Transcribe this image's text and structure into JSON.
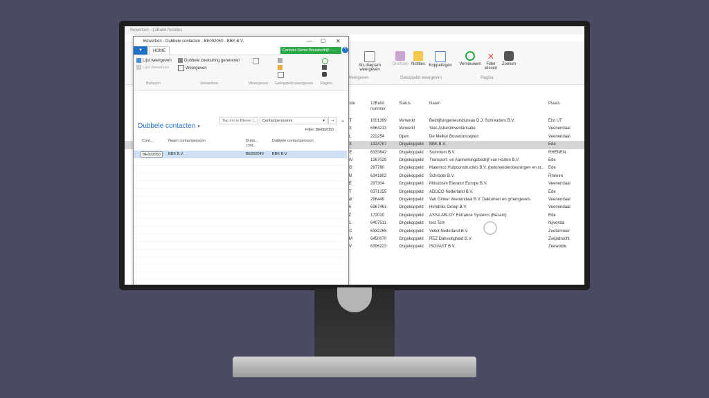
{
  "background_window": {
    "title": "Bewerken - 12Build Relaties",
    "ribbon": {
      "buttons": [
        {
          "label": "Als diagram weergeven"
        },
        {
          "label": "OneNote"
        },
        {
          "label": "Notities"
        },
        {
          "label": "Koppelingen"
        },
        {
          "label": "Vernieuwen"
        },
        {
          "label": "Filter wissen"
        },
        {
          "label": "Zoeken"
        }
      ],
      "groups": [
        "Weergeven",
        "Gekoppeld weergeven",
        "Pagina"
      ]
    },
    "columns": [
      "code",
      "12Build nummer",
      "Status",
      "Naam",
      "Plaats"
    ],
    "rows": [
      {
        "code": "DT",
        "num": "1001399",
        "status": "Verwerkt",
        "name": "Bedrijfsingenieursbureau D.J. Schreuders B.V.",
        "city": "Elst UT"
      },
      {
        "code": "AX",
        "num": "6364213",
        "status": "Verwerkt",
        "name": "Sias Asbestinventarisatie",
        "city": "Veenendaal"
      },
      {
        "code": "PL",
        "num": "222254",
        "status": "Open",
        "name": "De Melker Bouwconcepten",
        "city": "Veenendaal"
      },
      {
        "code": "BX",
        "num": "1324787",
        "status": "Ongekoppeld",
        "name": "BBK B.V.",
        "city": "Ede",
        "selected": true
      },
      {
        "code": "RE",
        "num": "6333642",
        "status": "Ongekoppeld",
        "name": "Somnium B.V.",
        "city": "RHENEN"
      },
      {
        "code": "WV",
        "num": "1267029",
        "status": "Ongekoppeld",
        "name": "Transport- en Aannemingsbedrijf van Harten B.V.",
        "city": "Ede"
      },
      {
        "code": "AG",
        "num": "297780",
        "status": "Ongekoppeld",
        "name": "Matemco Hulpconstructies B.V. (betonondersteuningen en st...",
        "city": "Ede"
      },
      {
        "code": "TN",
        "num": "6341802",
        "status": "Ongekoppeld",
        "name": "Schröder B.V.",
        "city": "Rhenen"
      },
      {
        "code": "AE",
        "num": "297304",
        "status": "Ongekoppeld",
        "name": "Mitsubishi Elevator Europe B.V.",
        "city": "Veenendaal"
      },
      {
        "code": "BT",
        "num": "6371255",
        "status": "Ongekoppeld",
        "name": "ADUCO Nederland B.V.",
        "city": "Ede"
      },
      {
        "code": "LW",
        "num": "296449",
        "status": "Ongekoppeld",
        "name": "Van Ginkel Veenendaal B.V. Daktuinen en groengevels",
        "city": "Veenendaal"
      },
      {
        "code": "LA",
        "num": "6367463",
        "status": "Ongekoppeld",
        "name": "Hendriks Groep B.V.",
        "city": "Veenendaal"
      },
      {
        "code": "LZ",
        "num": "172020",
        "status": "Ongekoppeld",
        "name": "ASSA ABLOY Entrance Systems (Besam)",
        "city": "Ede"
      },
      {
        "code": "DL",
        "num": "6407511",
        "status": "Ongekoppeld",
        "name": "test Tom",
        "city": "Nijverdal"
      },
      {
        "code": "RC",
        "num": "6332255",
        "status": "Ongekoppeld",
        "name": "Vetkit Nederland B.V.",
        "city": "Zoetermeer"
      },
      {
        "code": "AM",
        "num": "6450070",
        "status": "Ongekoppeld",
        "name": "REZ Dakveiligheid B.V.",
        "city": "Zwijndrecht"
      },
      {
        "code": "XV",
        "num": "6396223",
        "status": "Ongekoppeld",
        "name": "ISOVAST B.V.",
        "city": "Zeewolde"
      }
    ]
  },
  "dialog": {
    "title": "Bewerken - Dubbele contacten - BE002050 - BBK B.V.",
    "controls": {
      "minimize": "—",
      "maximize": "☐",
      "close": "✕"
    },
    "tab_file": "▼",
    "tab_home": "HOME",
    "company": "Contoso Demo Bouwbedrijf - ...",
    "help": "?",
    "ribbon": {
      "items": [
        {
          "label": "Lijst weergeven"
        },
        {
          "label": "Lijst bewerken"
        },
        {
          "label": "Dubbele zoekstring genereren"
        },
        {
          "label": "Weergeven"
        }
      ],
      "groups": [
        "Beheren",
        "Verwerken",
        "Weergeven",
        "Gekoppeld weergeven",
        "Pagina"
      ]
    },
    "page_title": "Dubbele contacten",
    "filter_placeholder": "Typ om te filteren (...",
    "filter_field": "Contactpersoonnr.",
    "filter_go": "→",
    "collapse": "⌄",
    "filter_status": "Filter: BE002050",
    "columns": [
      "Cont...",
      "Naam contactpersoon",
      "Dubb... cont...",
      "Dubbele contactpersoon"
    ],
    "row": {
      "contact_no": "BE002050",
      "name": "BBK B.V.",
      "dup_no": "BE002049",
      "dup_name": "BBK B.V."
    },
    "scroll_left": "‹",
    "scroll_right": "›"
  }
}
